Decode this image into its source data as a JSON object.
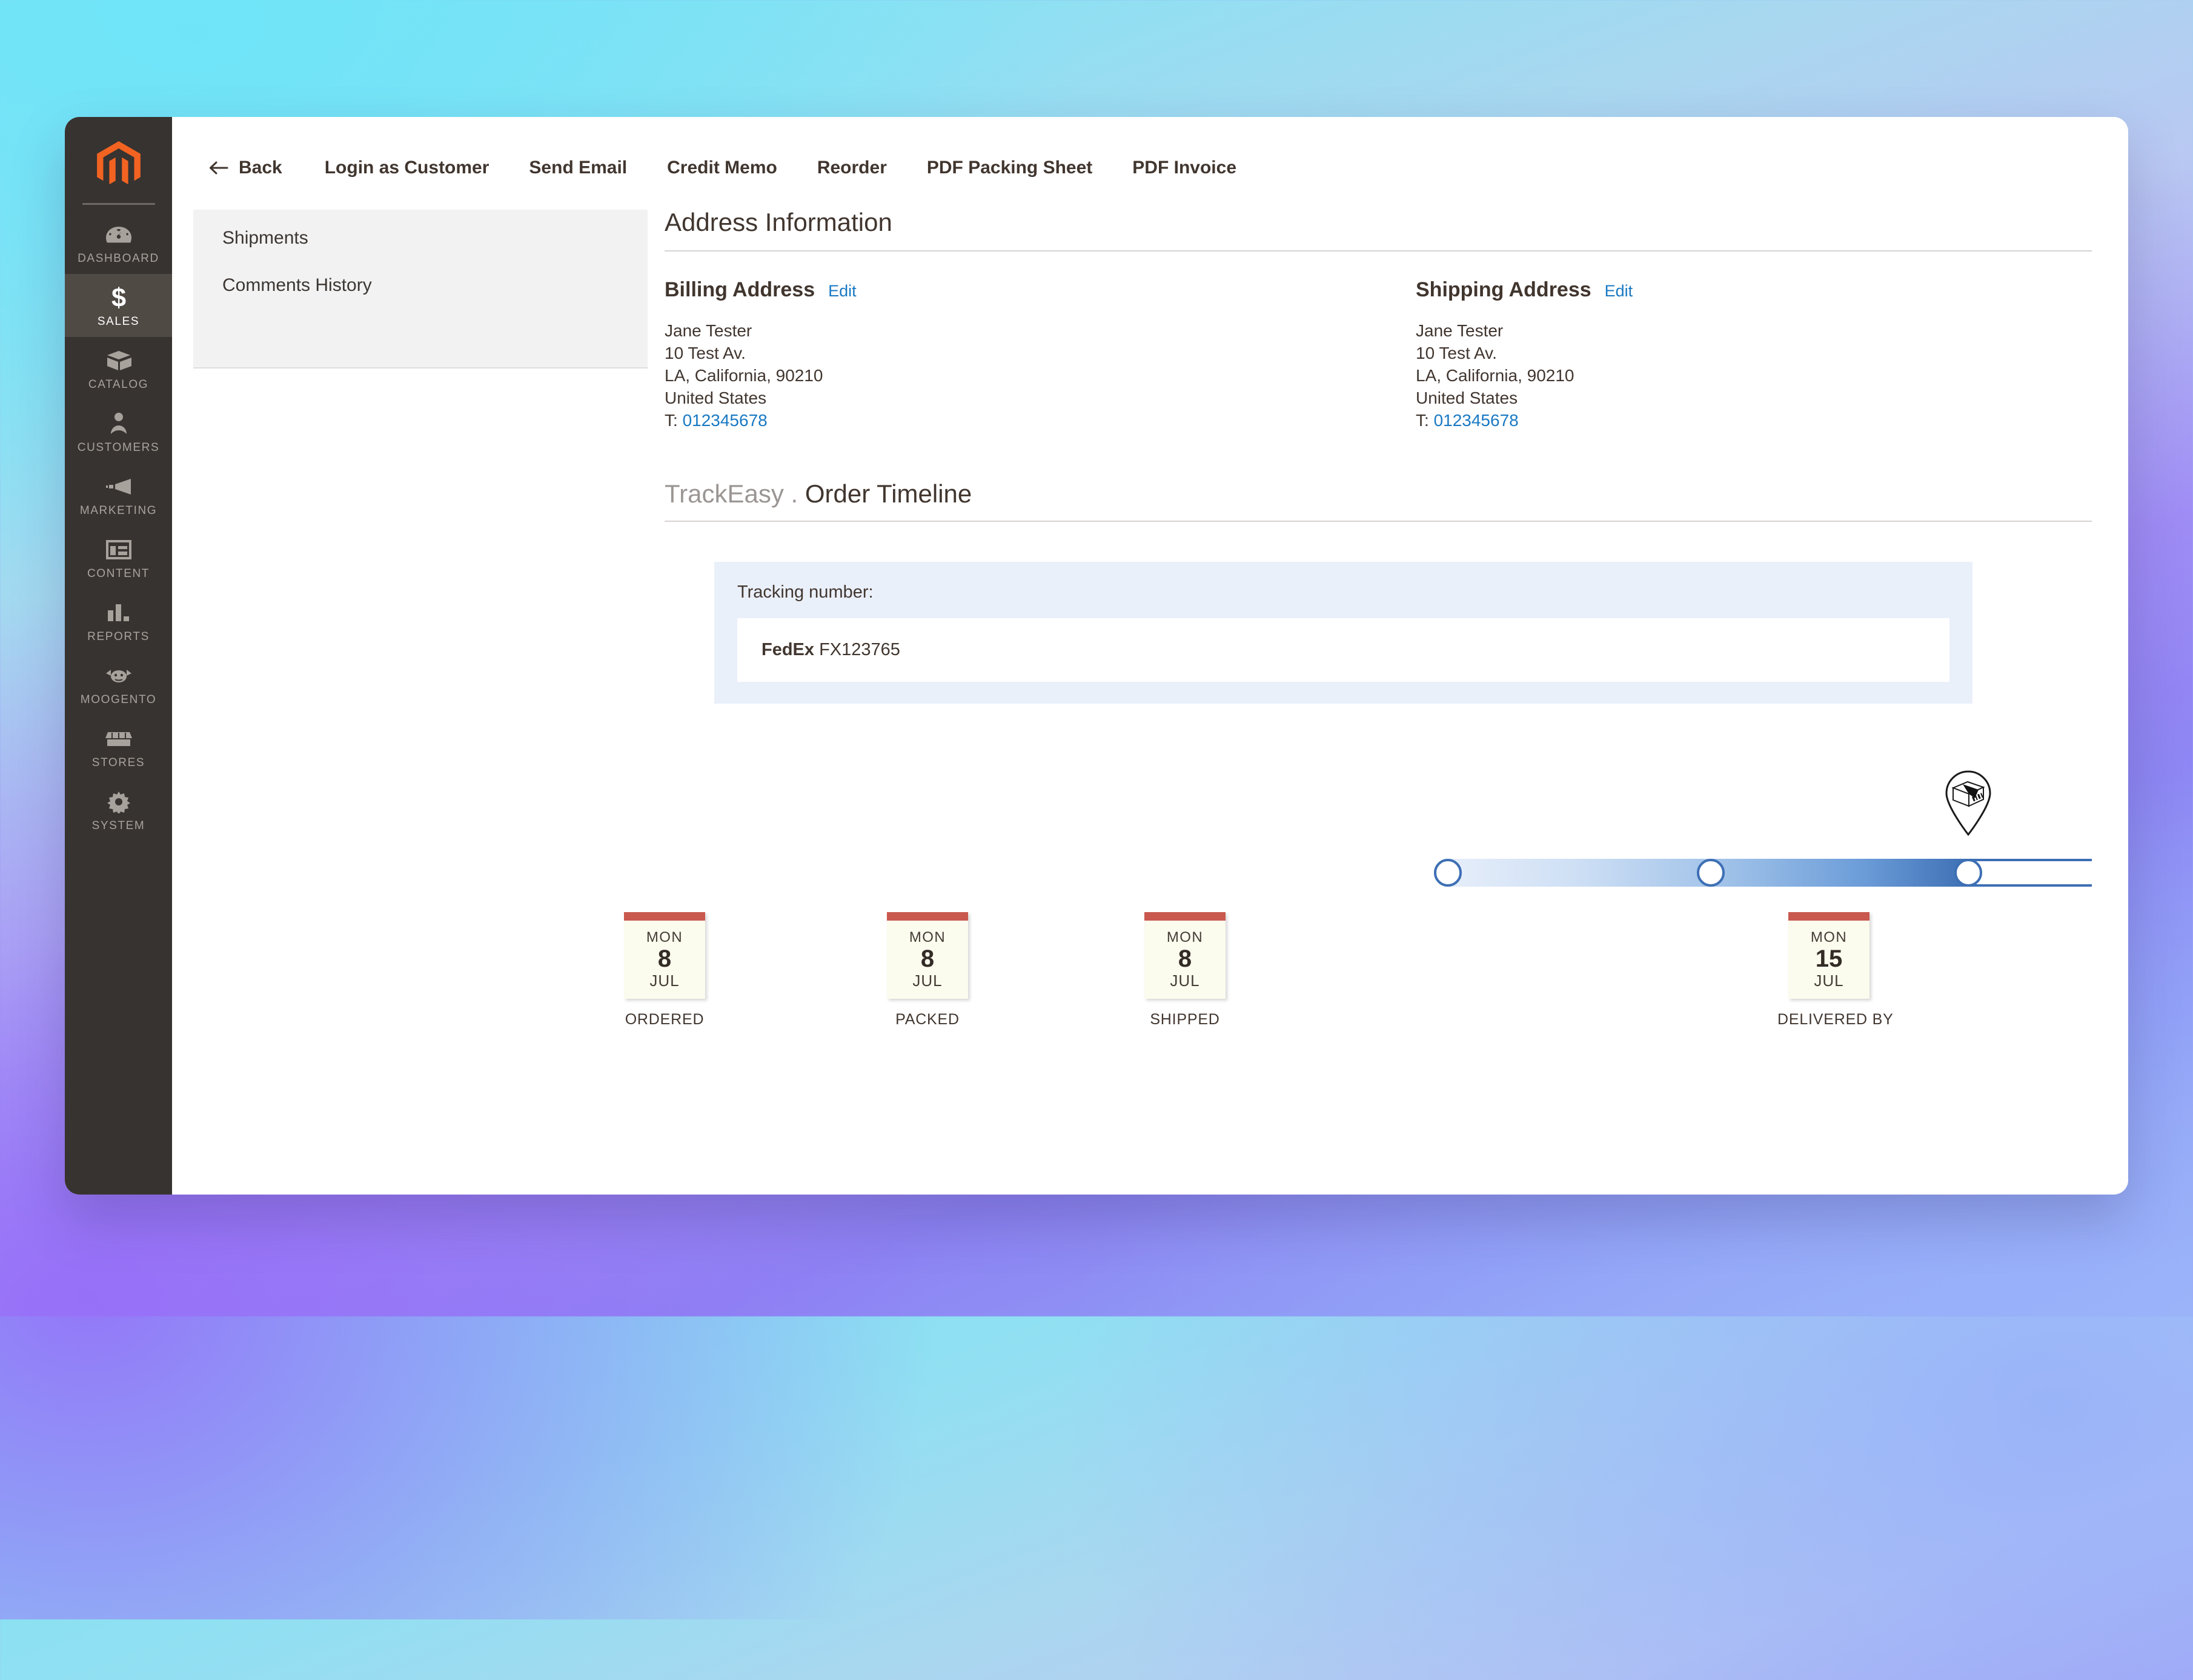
{
  "sidebar": {
    "logo": "magento-logo",
    "items": [
      {
        "label": "DASHBOARD",
        "icon": "dashboard-icon",
        "active": false
      },
      {
        "label": "SALES",
        "icon": "dollar-icon",
        "active": true
      },
      {
        "label": "CATALOG",
        "icon": "box-icon",
        "active": false
      },
      {
        "label": "CUSTOMERS",
        "icon": "person-icon",
        "active": false
      },
      {
        "label": "MARKETING",
        "icon": "megaphone-icon",
        "active": false
      },
      {
        "label": "CONTENT",
        "icon": "layout-icon",
        "active": false
      },
      {
        "label": "REPORTS",
        "icon": "bar-chart-icon",
        "active": false
      },
      {
        "label": "MOOGENTO",
        "icon": "moogento-cow-icon",
        "active": false
      },
      {
        "label": "STORES",
        "icon": "storefront-icon",
        "active": false
      },
      {
        "label": "SYSTEM",
        "icon": "gear-icon",
        "active": false
      }
    ]
  },
  "toolbar": {
    "back": "Back",
    "back_icon": "arrow-left-icon",
    "buttons": [
      "Login as Customer",
      "Send Email",
      "Credit Memo",
      "Reorder",
      "PDF Packing Sheet",
      "PDF Invoice"
    ]
  },
  "side_panel": {
    "items": [
      "Shipments",
      "Comments History"
    ]
  },
  "address": {
    "section_title": "Address Information",
    "edit_label": "Edit",
    "phone_prefix": "T:",
    "billing": {
      "heading": "Billing Address",
      "name": "Jane Tester",
      "street": "10 Test Av.",
      "city_region_zip": "LA, California, 90210",
      "country": "United States",
      "phone": "012345678"
    },
    "shipping": {
      "heading": "Shipping Address",
      "name": "Jane Tester",
      "street": "10 Test Av.",
      "city_region_zip": "LA, California, 90210",
      "country": "United States",
      "phone": "012345678"
    }
  },
  "timeline": {
    "brand": "TrackEasy .",
    "title": "Order Timeline",
    "tracking_label": "Tracking number:",
    "carrier": "FedEx",
    "tracking_number": "FX123765",
    "pin_icon": "package-pin-icon",
    "progress_percent": 45,
    "current_step_index": 2,
    "steps": [
      {
        "status": "ORDERED",
        "dow": "MON",
        "day": "8",
        "month": "JUL"
      },
      {
        "status": "PACKED",
        "dow": "MON",
        "day": "8",
        "month": "JUL"
      },
      {
        "status": "SHIPPED",
        "dow": "MON",
        "day": "8",
        "month": "JUL"
      },
      {
        "status": "DELIVERED BY",
        "dow": "MON",
        "day": "15",
        "month": "JUL"
      }
    ]
  },
  "colors": {
    "accent_blue": "#3d6fb4",
    "link_blue": "#1979c3",
    "magento_orange": "#f26322",
    "calendar_red": "#c9584f",
    "sidebar_dark": "#373330",
    "tracking_panel": "#eaf0fa"
  }
}
